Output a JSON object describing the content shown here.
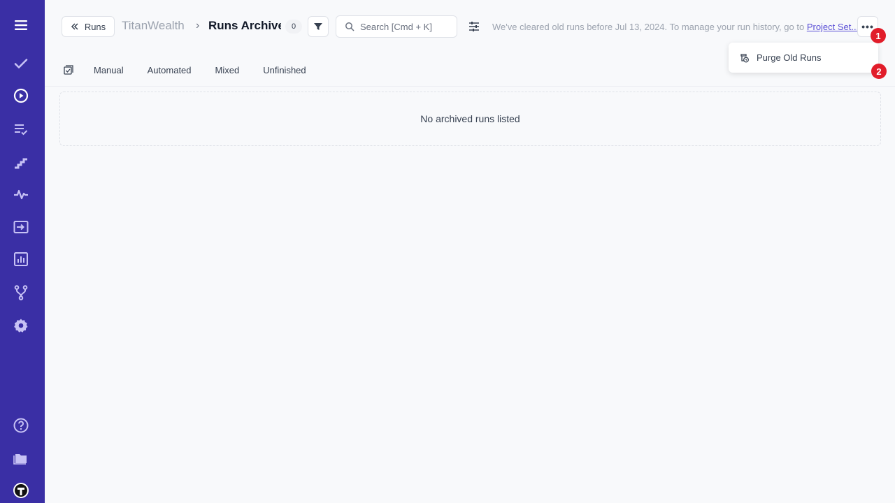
{
  "sidebar": {
    "items": [
      {
        "icon": "menu-icon"
      },
      {
        "icon": "check-icon"
      },
      {
        "icon": "play-circle-icon"
      },
      {
        "icon": "checklist-icon"
      },
      {
        "icon": "steps-icon"
      },
      {
        "icon": "pulse-icon"
      },
      {
        "icon": "import-icon"
      },
      {
        "icon": "bar-chart-icon"
      },
      {
        "icon": "branch-icon"
      },
      {
        "icon": "gear-icon"
      },
      {
        "icon": "help-icon"
      },
      {
        "icon": "folder-icon"
      },
      {
        "icon": "avatar-icon"
      }
    ],
    "bg_color": "#3a2fa5"
  },
  "header": {
    "back_label": "Runs",
    "project_name": "TitanWealth",
    "separator": "›",
    "title": "Runs Archive",
    "count": "0",
    "search_placeholder": "Search [Cmd + K]",
    "info_text": "We've cleared old runs before Jul 13, 2024. To manage your run history, go to ",
    "info_link": "Project Set...",
    "more_label": "•••"
  },
  "tabs": [
    "Manual",
    "Automated",
    "Mixed",
    "Unfinished"
  ],
  "empty_message": "No archived runs listed",
  "dropdown": {
    "item_label": "Purge Old Runs"
  },
  "markers": [
    "1",
    "2"
  ],
  "colors": {
    "accent": "#3a2fa5",
    "link": "#5b50d6",
    "marker": "#e11d2a"
  }
}
